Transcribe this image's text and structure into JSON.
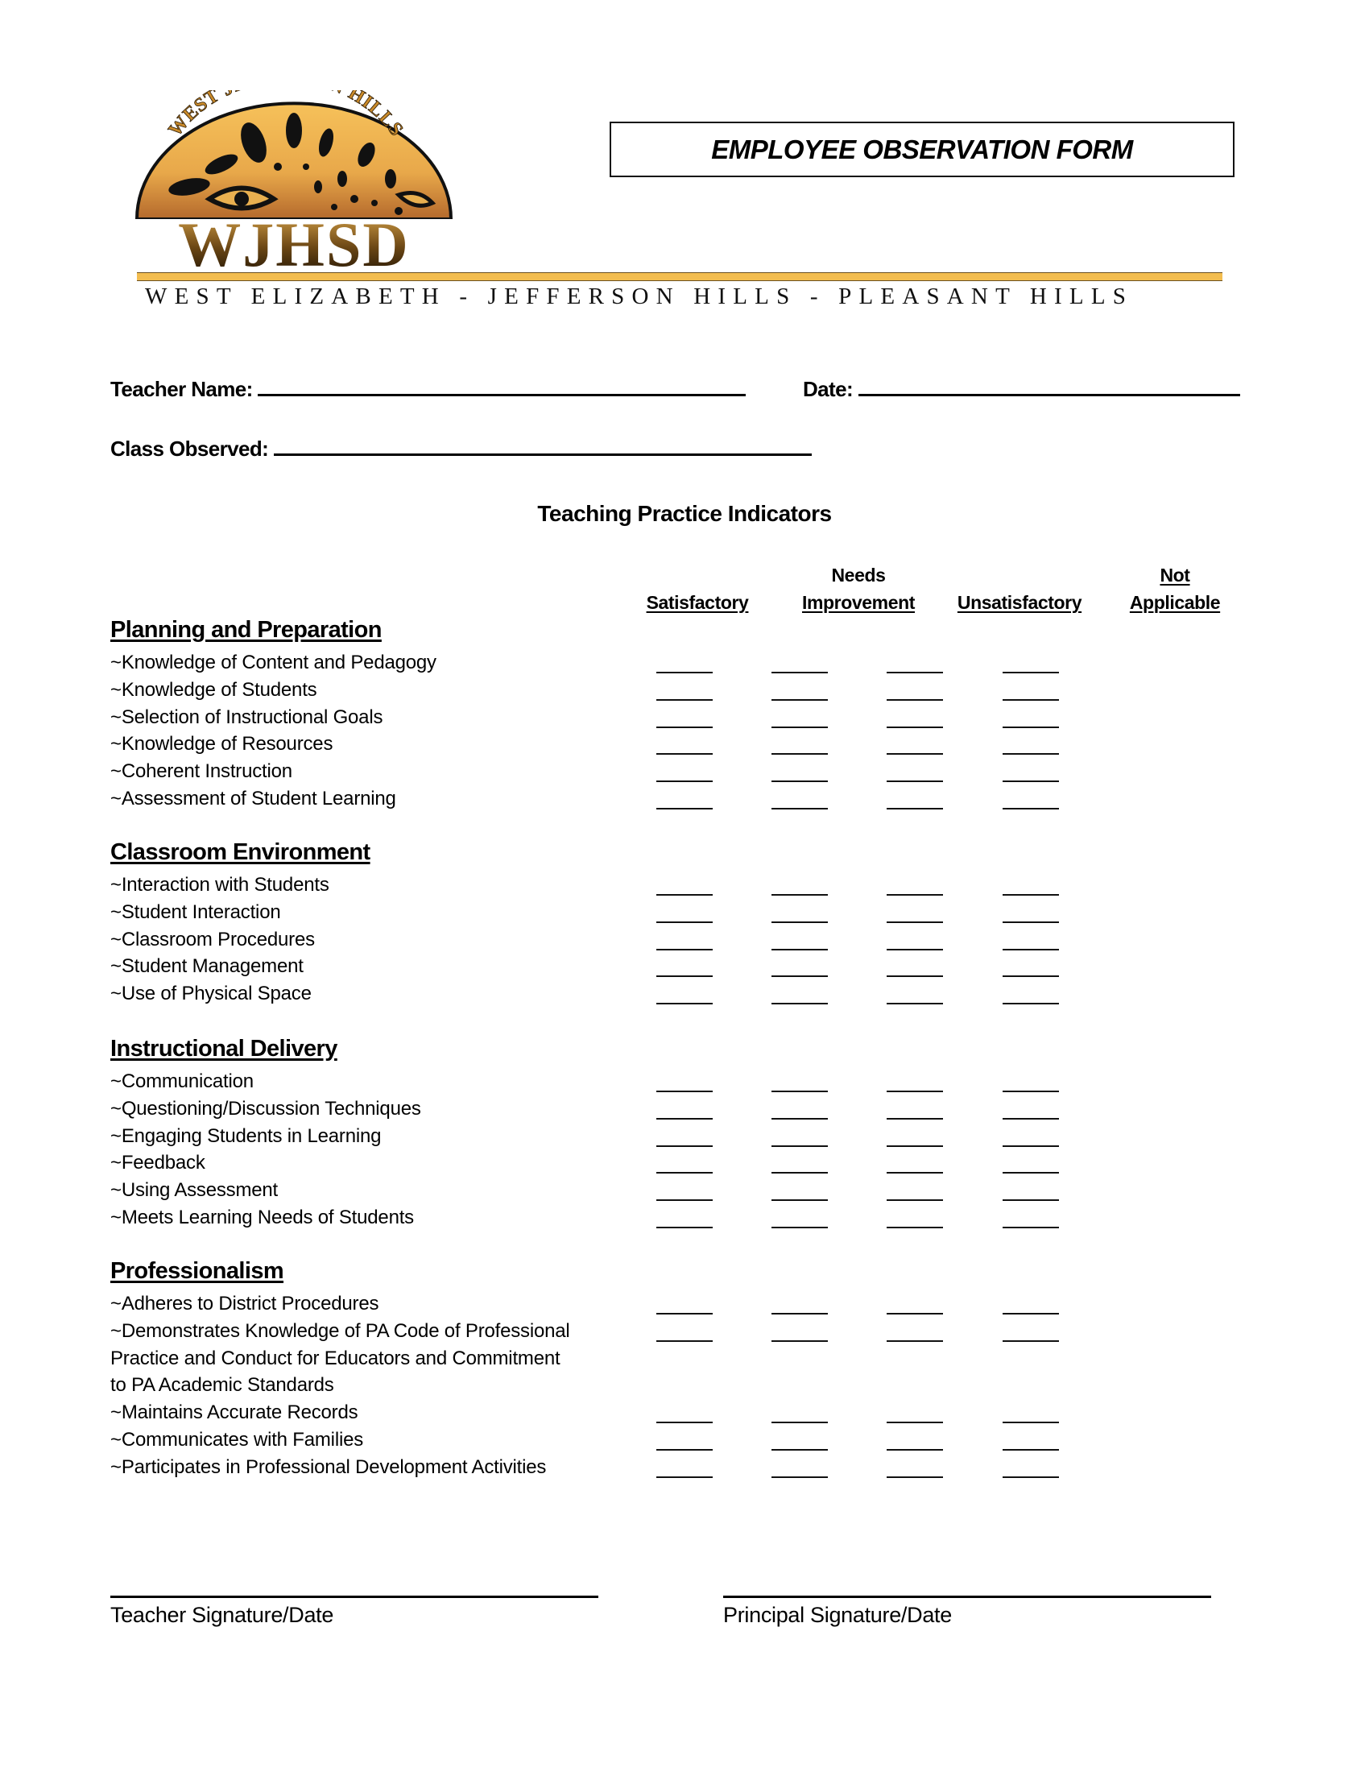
{
  "logo": {
    "arc_text": "WEST JEFFERSON HILLS",
    "monogram": "WJHSD",
    "tagline": "WEST ELIZABETH - JEFFERSON HILLS - PLEASANT HILLS",
    "colors": {
      "gold": "#f3bd4f",
      "dark": "#2a1a05",
      "amber": "#c98a2a"
    }
  },
  "form_title": "EMPLOYEE OBSERVATION FORM",
  "fields": {
    "teacher_name_label": "Teacher Name:",
    "teacher_name_value": "",
    "date_label": "Date:",
    "date_value": "",
    "class_observed_label": "Class Observed:",
    "class_observed_value": ""
  },
  "subtitle": "Teaching Practice Indicators",
  "columns": [
    {
      "line1": "",
      "line2": "Satisfactory",
      "line1_underlined": false
    },
    {
      "line1": "Needs",
      "line2": "Improvement",
      "line1_underlined": false
    },
    {
      "line1": "",
      "line2": "Unsatisfactory",
      "line1_underlined": false
    },
    {
      "line1": "Not",
      "line2": "Applicable",
      "line1_underlined": true
    }
  ],
  "sections": [
    {
      "title": "Planning and Preparation",
      "items": [
        "~Knowledge of Content and Pedagogy",
        "~Knowledge of Students",
        "~Selection of Instructional Goals",
        "~Knowledge of Resources",
        "~Coherent Instruction",
        "~Assessment of Student Learning"
      ]
    },
    {
      "title": "Classroom Environment",
      "items": [
        "~Interaction with Students",
        "~Student Interaction",
        "~Classroom Procedures",
        "~Student Management",
        "~Use of Physical Space"
      ]
    },
    {
      "title": "Instructional Delivery",
      "items": [
        "~Communication",
        "~Questioning/Discussion Techniques",
        "~Engaging Students in Learning",
        "~Feedback",
        "~Using Assessment",
        "~Meets Learning Needs of Students"
      ]
    },
    {
      "title": "Professionalism",
      "items": [
        "~Adheres to District Procedures",
        "~Demonstrates Knowledge of PA Code of Professional",
        "Practice and Conduct for Educators and Commitment",
        "to PA Academic Standards",
        "~Maintains Accurate Records",
        "~Communicates with Families",
        "~Participates in Professional Development Activities"
      ],
      "continuation_lines": [
        2,
        3
      ]
    }
  ],
  "signatures": {
    "teacher_label": "Teacher Signature/Date",
    "principal_label": "Principal Signature/Date"
  }
}
